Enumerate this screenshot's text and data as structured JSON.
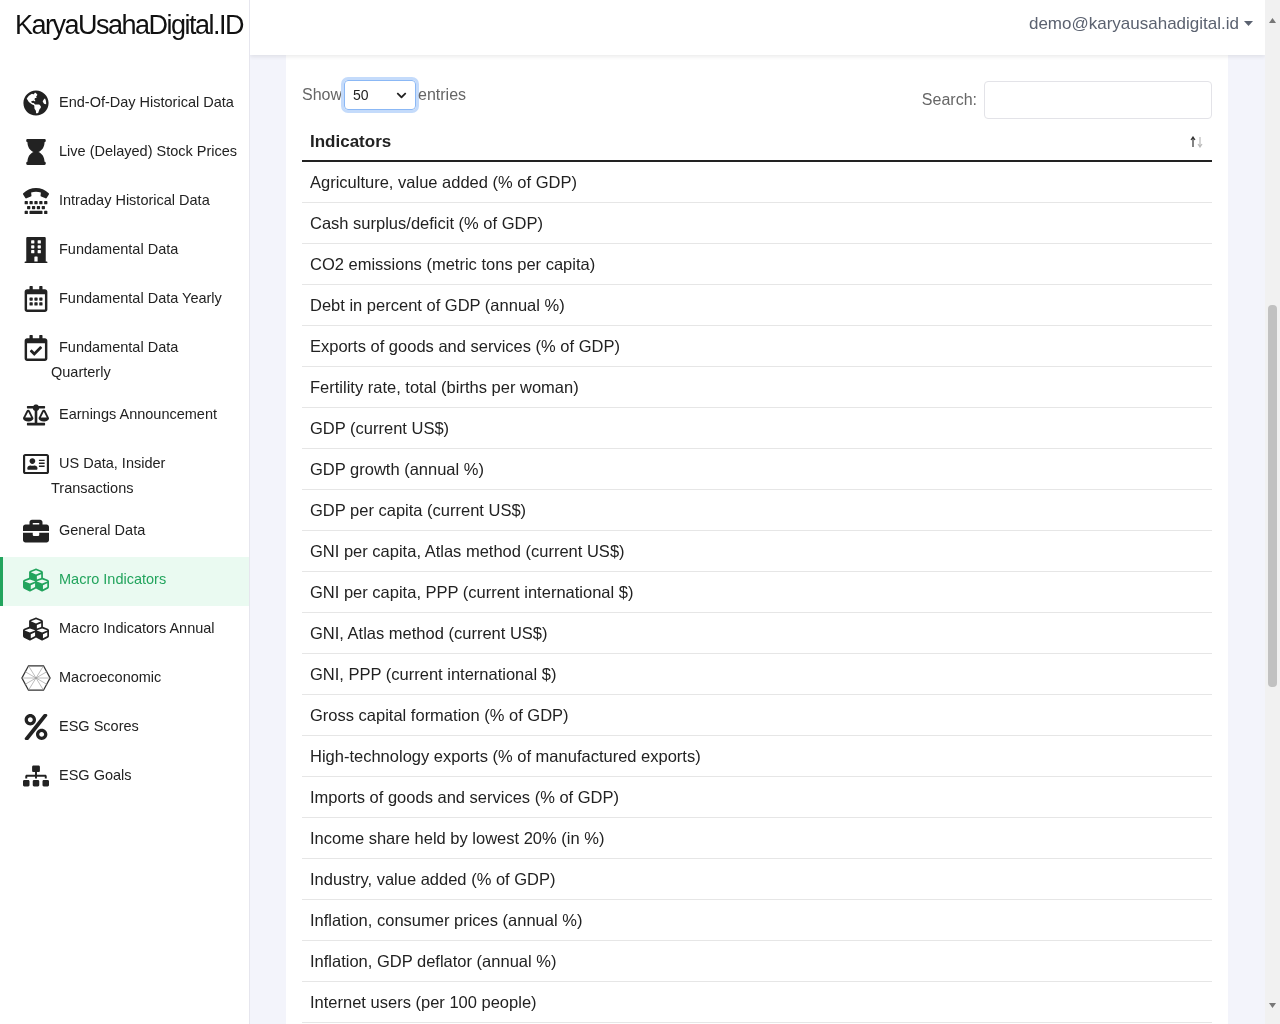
{
  "brand": "KaryaUsahaDigital.ID",
  "user_menu": {
    "label": "demo@karyausahadigital.id"
  },
  "sidebar": {
    "items": [
      {
        "label": "End-Of-Day Historical Data",
        "selected": false
      },
      {
        "label": "Live (Delayed) Stock Prices",
        "selected": false
      },
      {
        "label": "Intraday Historical Data",
        "selected": false
      },
      {
        "label": "Fundamental Data",
        "selected": false
      },
      {
        "label": "Fundamental Data Yearly",
        "selected": false
      },
      {
        "label": "Fundamental Data Quarterly",
        "selected": false
      },
      {
        "label": "Earnings Announcement",
        "selected": false
      },
      {
        "label": "US Data, Insider Transactions",
        "selected": false
      },
      {
        "label": "General Data",
        "selected": false
      },
      {
        "label": "Macro Indicators",
        "selected": true
      },
      {
        "label": "Macro Indicators Annual",
        "selected": false
      },
      {
        "label": "Macroeconomic",
        "selected": false
      },
      {
        "label": "ESG Scores",
        "selected": false
      },
      {
        "label": "ESG Goals",
        "selected": false
      }
    ]
  },
  "table": {
    "show_label": "Show",
    "page_size": "50",
    "entries_label": "entries",
    "search_label": "Search:",
    "column": "Indicators",
    "rows": [
      "Agriculture, value added (% of GDP)",
      "Cash surplus/deficit (% of GDP)",
      "CO2 emissions (metric tons per capita)",
      "Debt in percent of GDP (annual %)",
      "Exports of goods and services (% of GDP)",
      "Fertility rate, total (births per woman)",
      "GDP (current US$)",
      "GDP growth (annual %)",
      "GDP per capita (current US$)",
      "GNI per capita, Atlas method (current US$)",
      "GNI per capita, PPP (current international $)",
      "GNI, Atlas method (current US$)",
      "GNI, PPP (current international $)",
      "Gross capital formation (% of GDP)",
      "High-technology exports (% of manufactured exports)",
      "Imports of goods and services (% of GDP)",
      "Income share held by lowest 20% (in %)",
      "Industry, value added (% of GDP)",
      "Inflation, consumer prices (annual %)",
      "Inflation, GDP deflator (annual %)",
      "Internet users (per 100 people)"
    ]
  }
}
